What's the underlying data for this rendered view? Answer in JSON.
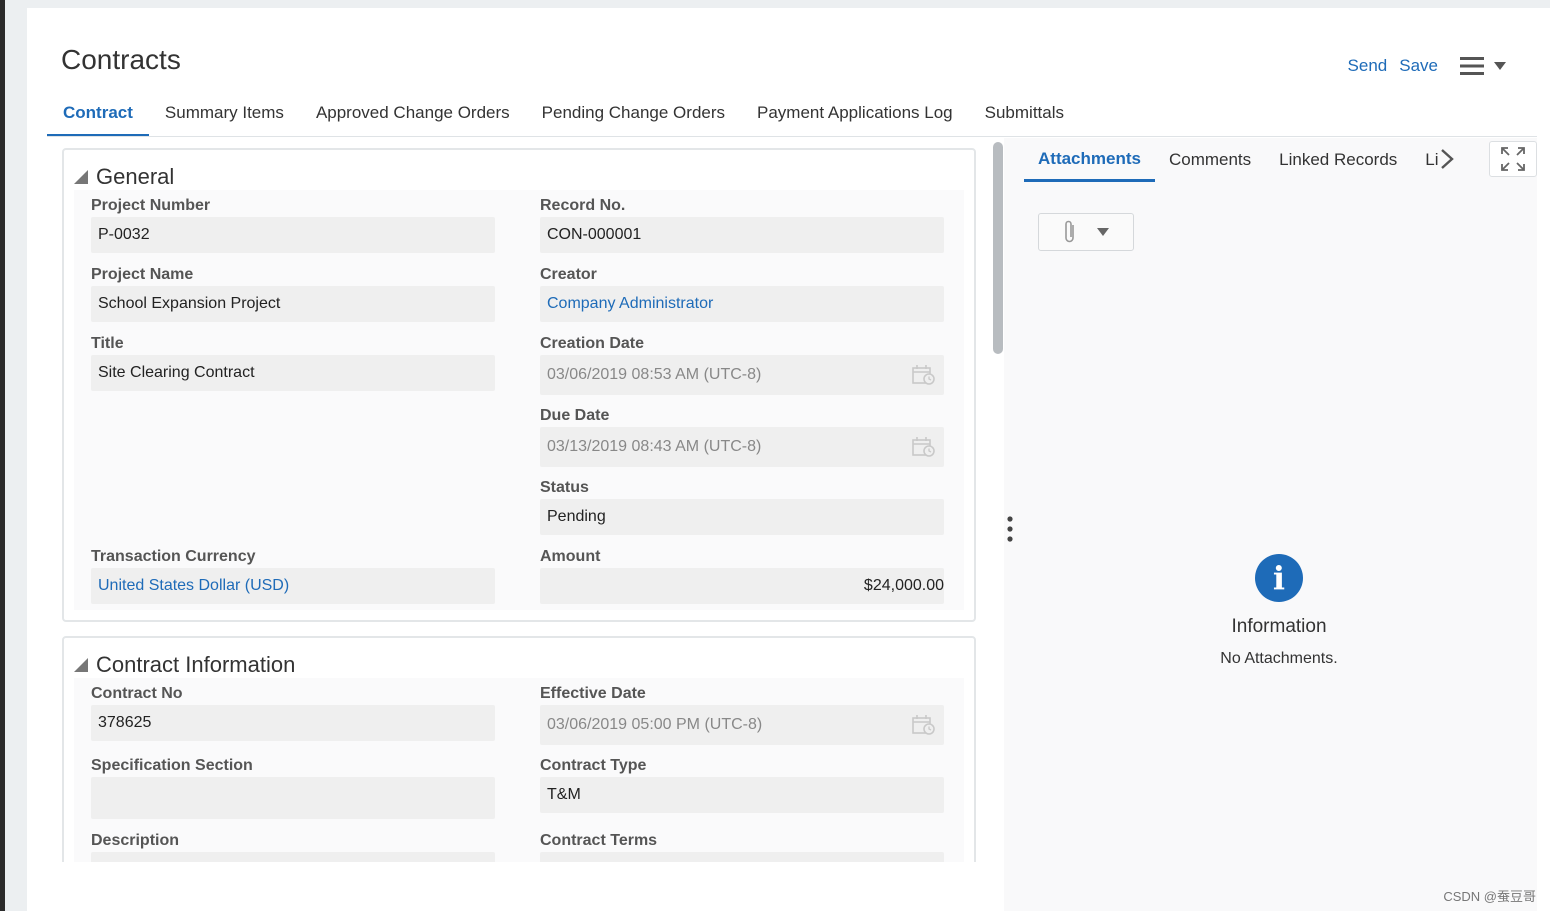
{
  "page": {
    "title": "Contracts"
  },
  "header": {
    "send_label": "Send",
    "save_label": "Save",
    "menu_icon": "hamburger-menu-icon"
  },
  "tabs": [
    {
      "label": "Contract",
      "active": true
    },
    {
      "label": "Summary Items"
    },
    {
      "label": "Approved Change Orders"
    },
    {
      "label": "Pending Change Orders"
    },
    {
      "label": "Payment Applications Log"
    },
    {
      "label": "Submittals"
    }
  ],
  "general": {
    "title": "General",
    "project_number": {
      "label": "Project Number",
      "value": "P-0032"
    },
    "record_no": {
      "label": "Record No.",
      "value": "CON-000001"
    },
    "project_name": {
      "label": "Project Name",
      "value": "School Expansion Project"
    },
    "creator": {
      "label": "Creator",
      "value": "Company Administrator"
    },
    "title_field": {
      "label": "Title",
      "value": "Site Clearing Contract"
    },
    "creation_date": {
      "label": "Creation Date",
      "value": "03/06/2019 08:53 AM  (UTC-8)"
    },
    "due_date": {
      "label": "Due Date",
      "value": "03/13/2019 08:43 AM  (UTC-8)"
    },
    "status": {
      "label": "Status",
      "value": "Pending"
    },
    "transaction_currency": {
      "label": "Transaction Currency",
      "value": "United States Dollar (USD)"
    },
    "amount": {
      "label": "Amount",
      "value": "$24,000.00"
    }
  },
  "contract_info": {
    "title": "Contract Information",
    "contract_no": {
      "label": "Contract No",
      "value": "378625"
    },
    "effective_date": {
      "label": "Effective Date",
      "value": "03/06/2019 05:00 PM  (UTC-8)"
    },
    "specification_section": {
      "label": "Specification Section",
      "value": ""
    },
    "contract_type": {
      "label": "Contract Type",
      "value": "T&M"
    },
    "description": {
      "label": "Description",
      "value": ""
    },
    "contract_terms": {
      "label": "Contract Terms",
      "value": ""
    }
  },
  "right_panel": {
    "tabs": [
      {
        "label": "Attachments",
        "active": true
      },
      {
        "label": "Comments"
      },
      {
        "label": "Linked Records"
      },
      {
        "label": "Li"
      }
    ],
    "info_title": "Information",
    "info_text": "No Attachments."
  },
  "watermark": "CSDN @蚕豆哥",
  "colors": {
    "accent": "#1e6bb8",
    "field_bg": "#efefef",
    "page_bg": "#ffffff"
  }
}
